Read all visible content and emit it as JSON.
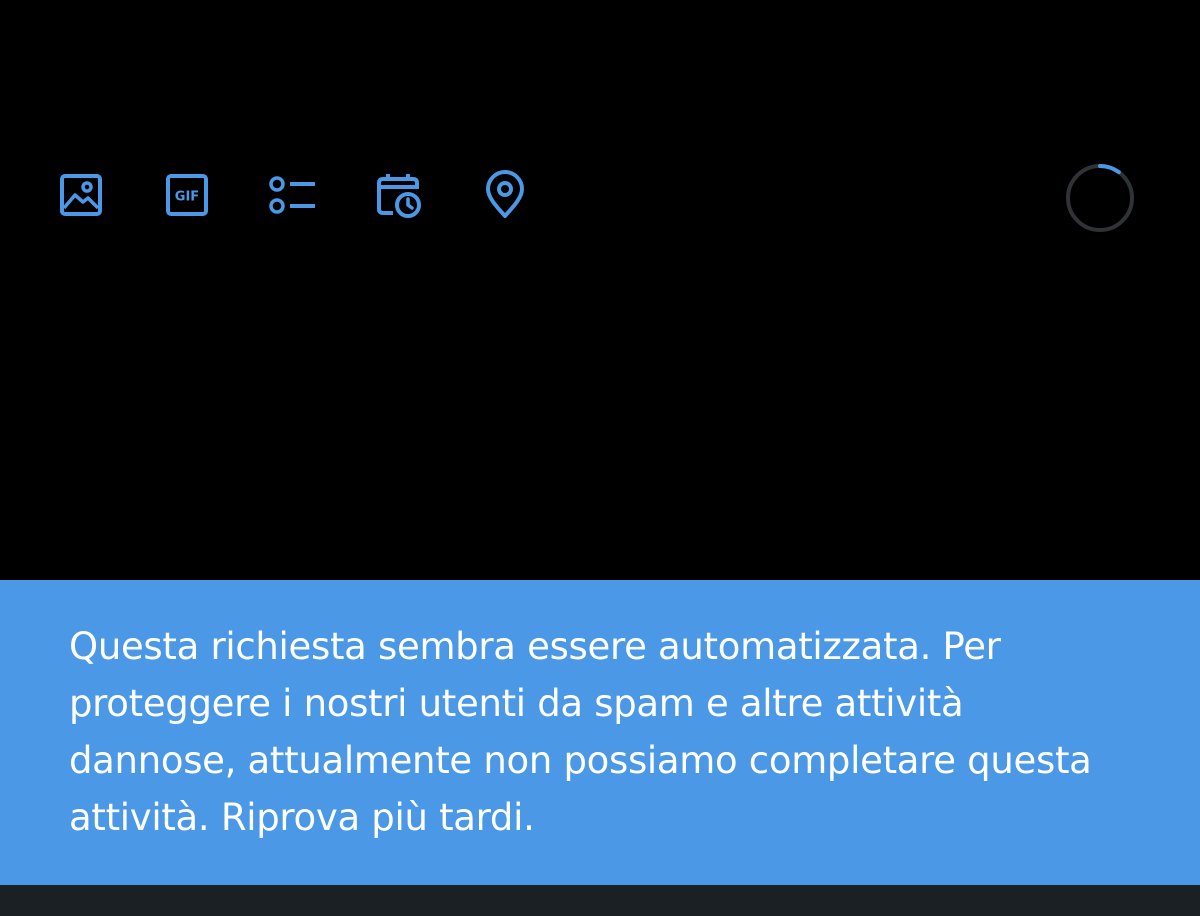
{
  "composer": {
    "toolbar": {
      "accent_color": "#4a98e6",
      "items": [
        {
          "name": "media",
          "icon": "image-icon"
        },
        {
          "name": "gif",
          "icon": "gif-icon",
          "label": "GIF"
        },
        {
          "name": "poll",
          "icon": "poll-icon"
        },
        {
          "name": "schedule",
          "icon": "schedule-calendar-icon"
        },
        {
          "name": "location",
          "icon": "location-pin-icon"
        }
      ]
    },
    "character_progress": {
      "icon": "circular-progress-ring",
      "fraction": 0.1,
      "track_color": "#2f3336",
      "fill_color": "#4a98e6"
    }
  },
  "toast": {
    "background": "#4a98e6",
    "message": "Questa richiesta sembra essere automatizzata. Per proteggere i nostri utenti da spam e altre attività dannose, attualmente non possiamo completare questa attività. Riprova più tardi."
  }
}
